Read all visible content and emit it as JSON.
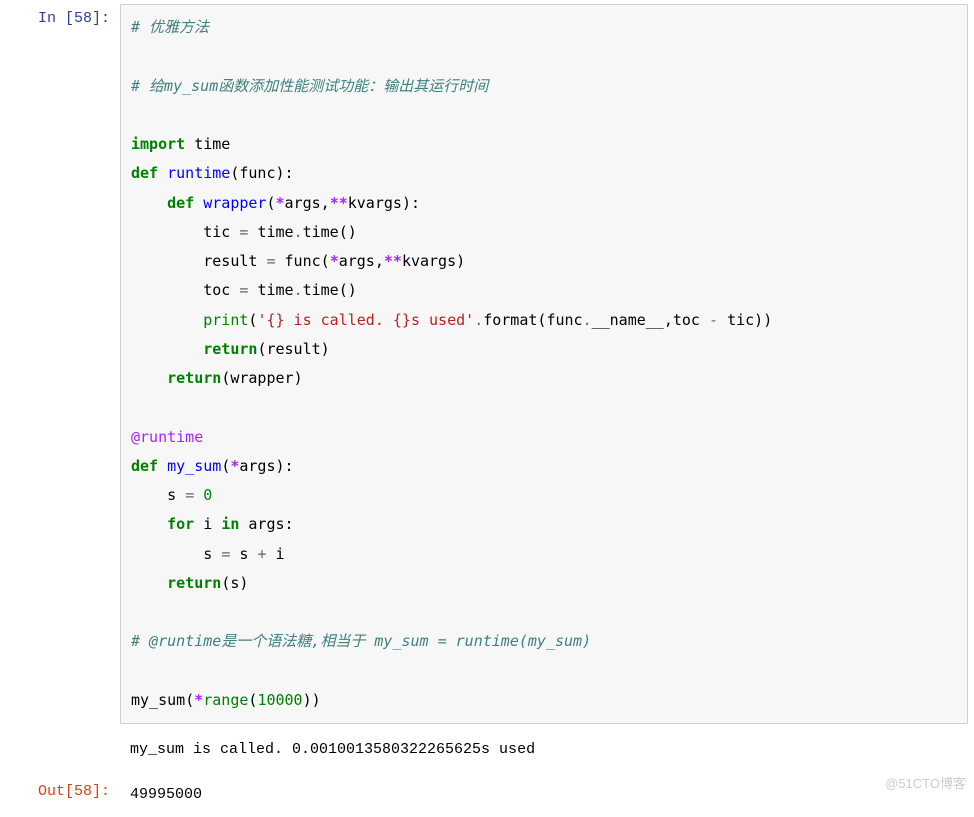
{
  "input": {
    "prompt": "In [58]:",
    "code": {
      "l1_comment": "# 优雅方法",
      "l2_comment": "# 给my_sum函数添加性能测试功能：输出其运行时间",
      "kw_import": "import",
      "mod_time": "time",
      "kw_def": "def",
      "fn_runtime": "runtime",
      "arg_func": "func",
      "fn_wrapper": "wrapper",
      "star": "*",
      "dstar": "**",
      "arg_args": "args",
      "arg_kvargs": "kvargs",
      "var_tic": "tic",
      "eq": "=",
      "time_time": "time",
      "dot": ".",
      "call_time": "time",
      "var_result": "result",
      "var_toc": "toc",
      "fn_print": "print",
      "str_fmt": "'{} is called. {}s used'",
      "fn_format": "format",
      "dunder_name": "__name__",
      "minus": "-",
      "kw_return": "return",
      "decorator": "@runtime",
      "fn_mysum": "my_sum",
      "var_s": "s",
      "zero": "0",
      "kw_for": "for",
      "var_i": "i",
      "kw_in": "in",
      "plus": "+",
      "l_comment3": "# @runtime是一个语法糖,相当于 my_sum = runtime(my_sum)",
      "fn_range": "range",
      "num_10000": "10000",
      "lp": "(",
      "rp": ")",
      "comma": ",",
      "colon": ":"
    }
  },
  "stdout": "my_sum is called. 0.0010013580322265625s used",
  "output": {
    "prompt": "Out[58]:",
    "value": "49995000"
  },
  "watermark": "@51CTO博客"
}
